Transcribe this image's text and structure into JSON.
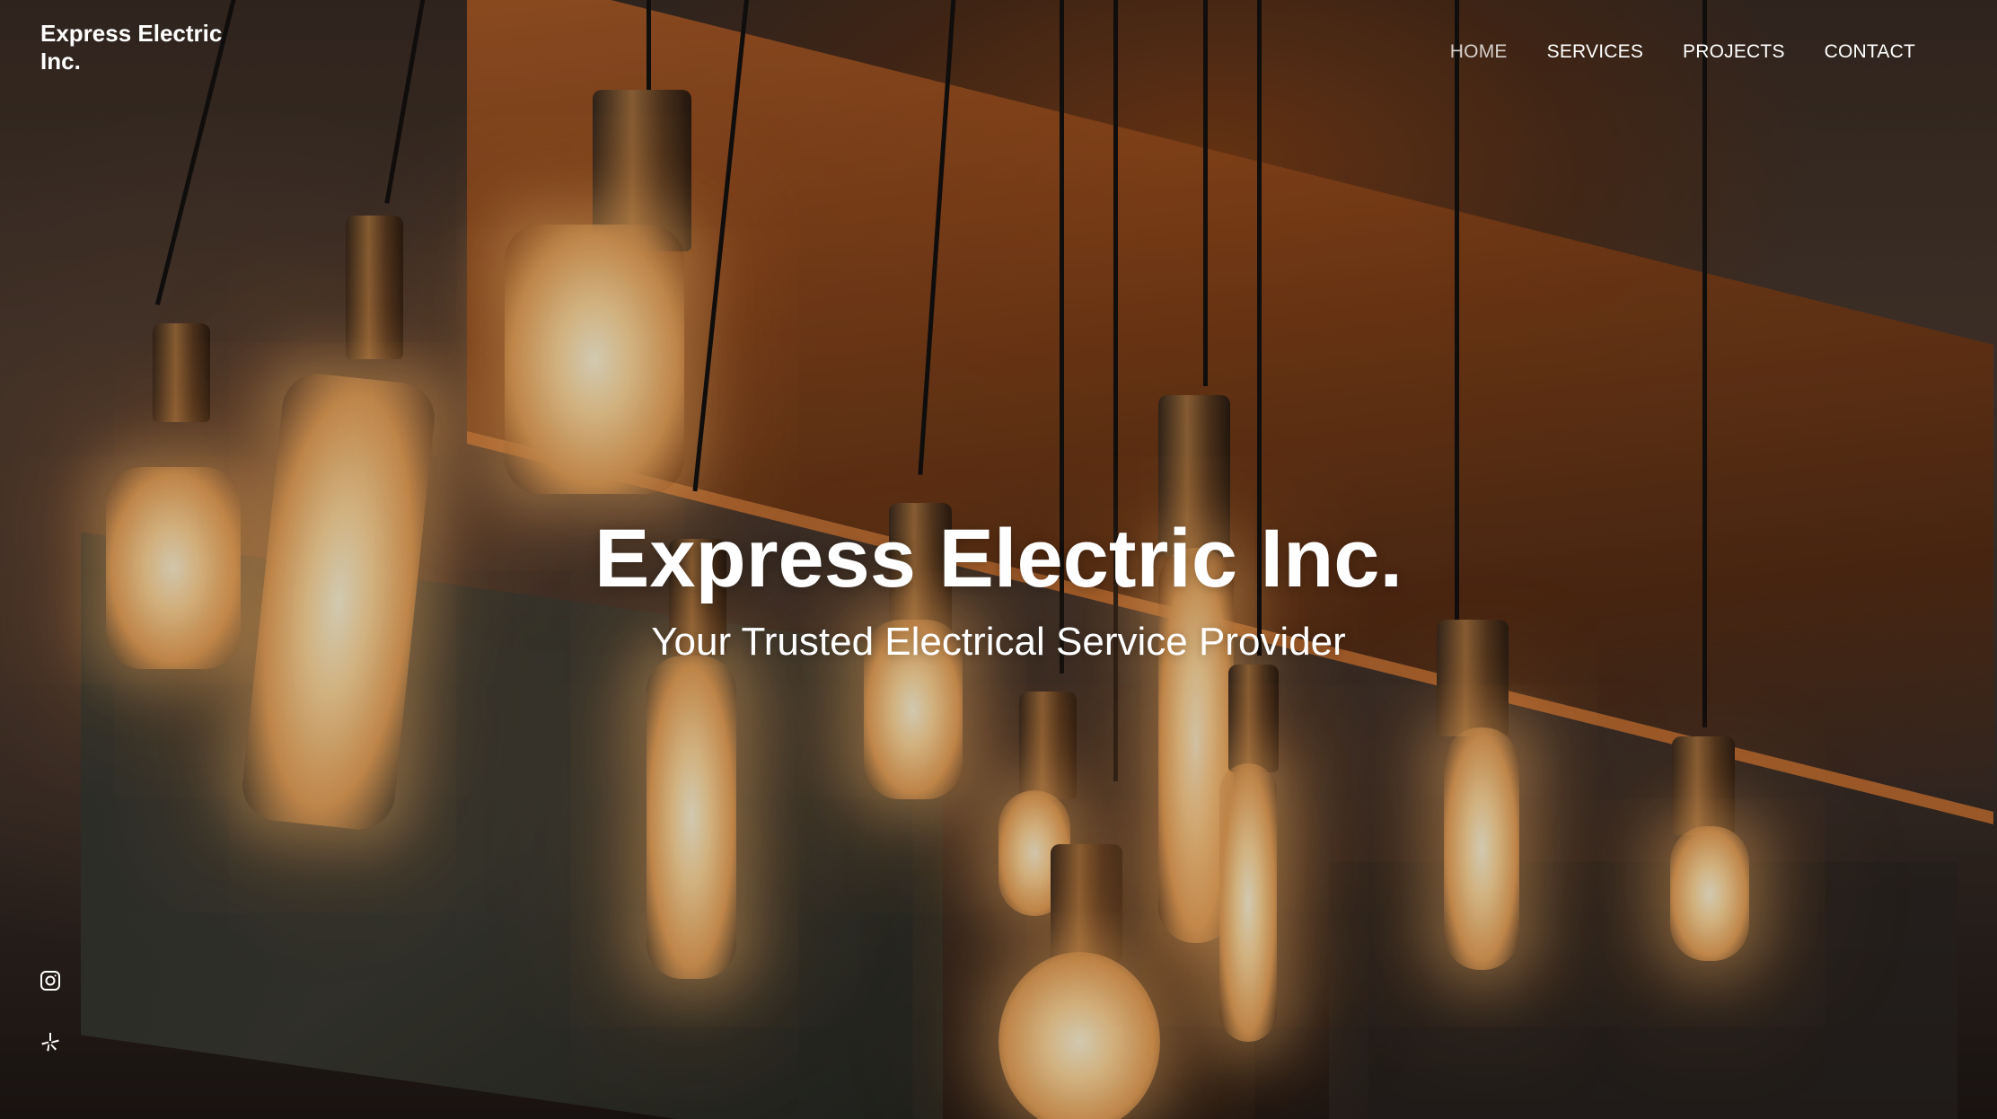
{
  "header": {
    "site_title": "Express Electric Inc.",
    "nav": [
      {
        "label": "HOME",
        "active": true
      },
      {
        "label": "SERVICES",
        "active": false
      },
      {
        "label": "PROJECTS",
        "active": false
      },
      {
        "label": "CONTACT",
        "active": false
      }
    ]
  },
  "hero": {
    "headline": "Express Electric Inc.",
    "tagline": "Your Trusted Electrical Service Provider",
    "background": "hanging edison light bulbs"
  },
  "social": [
    {
      "icon": "instagram-icon"
    },
    {
      "icon": "yelp-icon"
    }
  ],
  "colors": {
    "text": "#ffffff",
    "bulb_glow": "#ffd89a",
    "wood": "#c0652a"
  }
}
